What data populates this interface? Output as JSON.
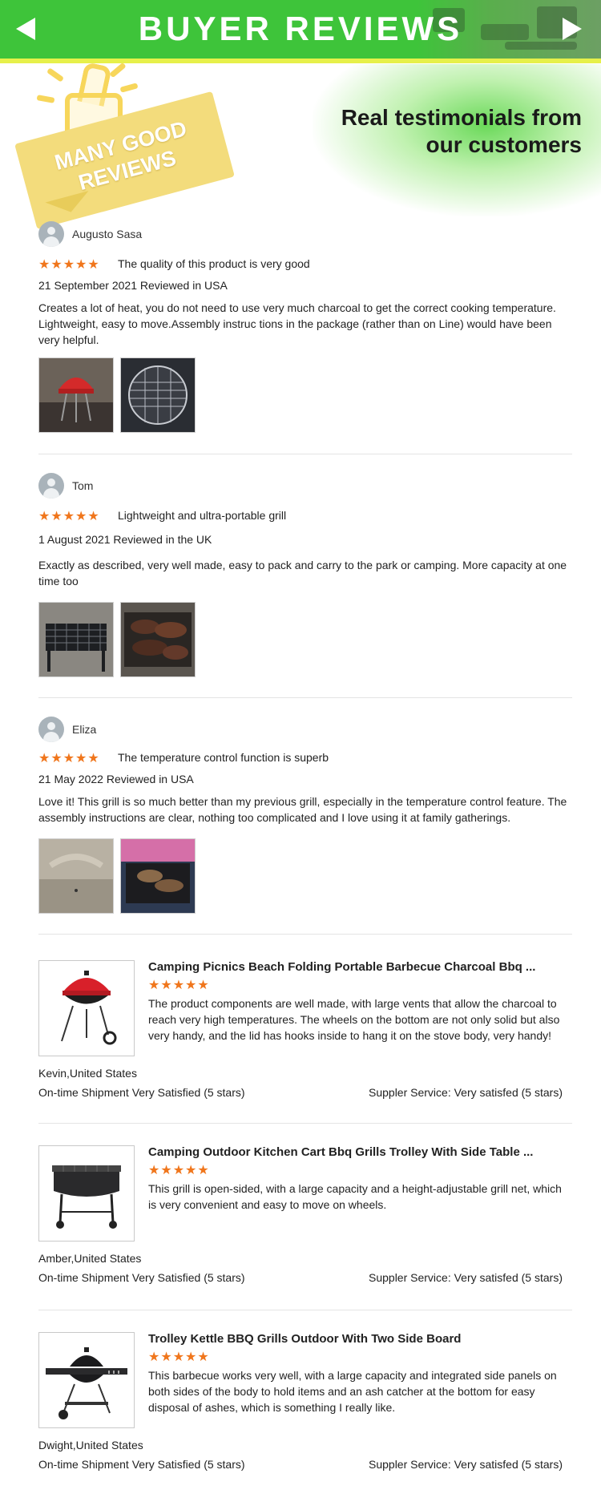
{
  "header": {
    "title": "BUYER REVIEWS",
    "prev_icon": "triangle-left-icon",
    "next_icon": "triangle-right-icon"
  },
  "hero": {
    "badge_text": "MANY GOOD REVIEWS",
    "tagline_line1": "Real testimonials from",
    "tagline_line2": "our customers"
  },
  "colors": {
    "brand_green": "#3ec43a",
    "star_orange": "#f0761c",
    "badge_yellow": "#f3dc7c"
  },
  "reviews": [
    {
      "name": "Augusto Sasa",
      "stars": "★★★★★",
      "headline": "The quality of this product is very good",
      "date": "21 September 2021 Reviewed in USA",
      "text": "Creates a lot of heat, you do not need to use very much charcoal to get the correct cooking temperature. Lightweight, easy to move.Assembly instruc tions in the package (rather than on Line) would have been very helpful.",
      "photos": [
        "red kettle grill photo",
        "round grill grate photo"
      ]
    },
    {
      "name": "Tom",
      "stars": "★★★★★",
      "headline": "Lightweight and ultra-portable grill",
      "date": "1 August 2021 Reviewed in the UK",
      "text": "Exactly as described, very well made, easy to pack and carry to the park or camping. More capacity at one time too",
      "photos": [
        "portable grill photo",
        "grilled meat photo"
      ]
    },
    {
      "name": "Eliza",
      "stars": "★★★★★",
      "headline": "The temperature control function is superb",
      "date": "21 May 2022 Reviewed in USA",
      "text": "Love it! This grill is so much better than my previous grill, especially in the temperature control feature. The assembly instructions are clear, nothing too complicated and I love using it at family gatherings.",
      "photos": [
        "grill handle photo",
        "grill with meat photo"
      ]
    }
  ],
  "products": [
    {
      "title": "Camping Picnics Beach Folding Portable Barbecue Charcoal Bbq ...",
      "stars": "★★★★★",
      "text": "The product components are well made, with large vents that allow the charcoal to reach very high temperatures. The wheels on the bottom are not only solid but also very handy, and the lid has hooks inside to hang it on the stove body, very handy!",
      "location": "Kevin,United States",
      "shipment": "On-time Shipment Very Satisfied (5 stars)",
      "service": "Suppler Service: Very satisfed (5 stars)",
      "image": "red kettle grill"
    },
    {
      "title": "Camping Outdoor Kitchen Cart Bbq Grills Trolley With Side Table ...",
      "stars": "★★★★★",
      "text": "This grill is open-sided, with a large capacity and a height-adjustable grill net, which is very convenient and easy to move on wheels.",
      "location": "Amber,United States",
      "shipment": "On-time Shipment Very Satisfied (5 stars)",
      "service": "Suppler Service: Very satisfed (5 stars)",
      "image": "barrel trolley grill"
    },
    {
      "title": "Trolley Kettle BBQ Grills Outdoor With Two Side Board",
      "stars": "★★★★★",
      "text": "This barbecue works very well, with a large capacity and integrated side panels on both sides of the body to hold items and an ash catcher at the bottom for easy disposal of ashes, which is something I really like.",
      "location": "Dwight,United States",
      "shipment": "On-time Shipment Very Satisfied (5 stars)",
      "service": "Suppler Service: Very satisfed (5 stars)",
      "image": "black kettle trolley grill"
    }
  ]
}
